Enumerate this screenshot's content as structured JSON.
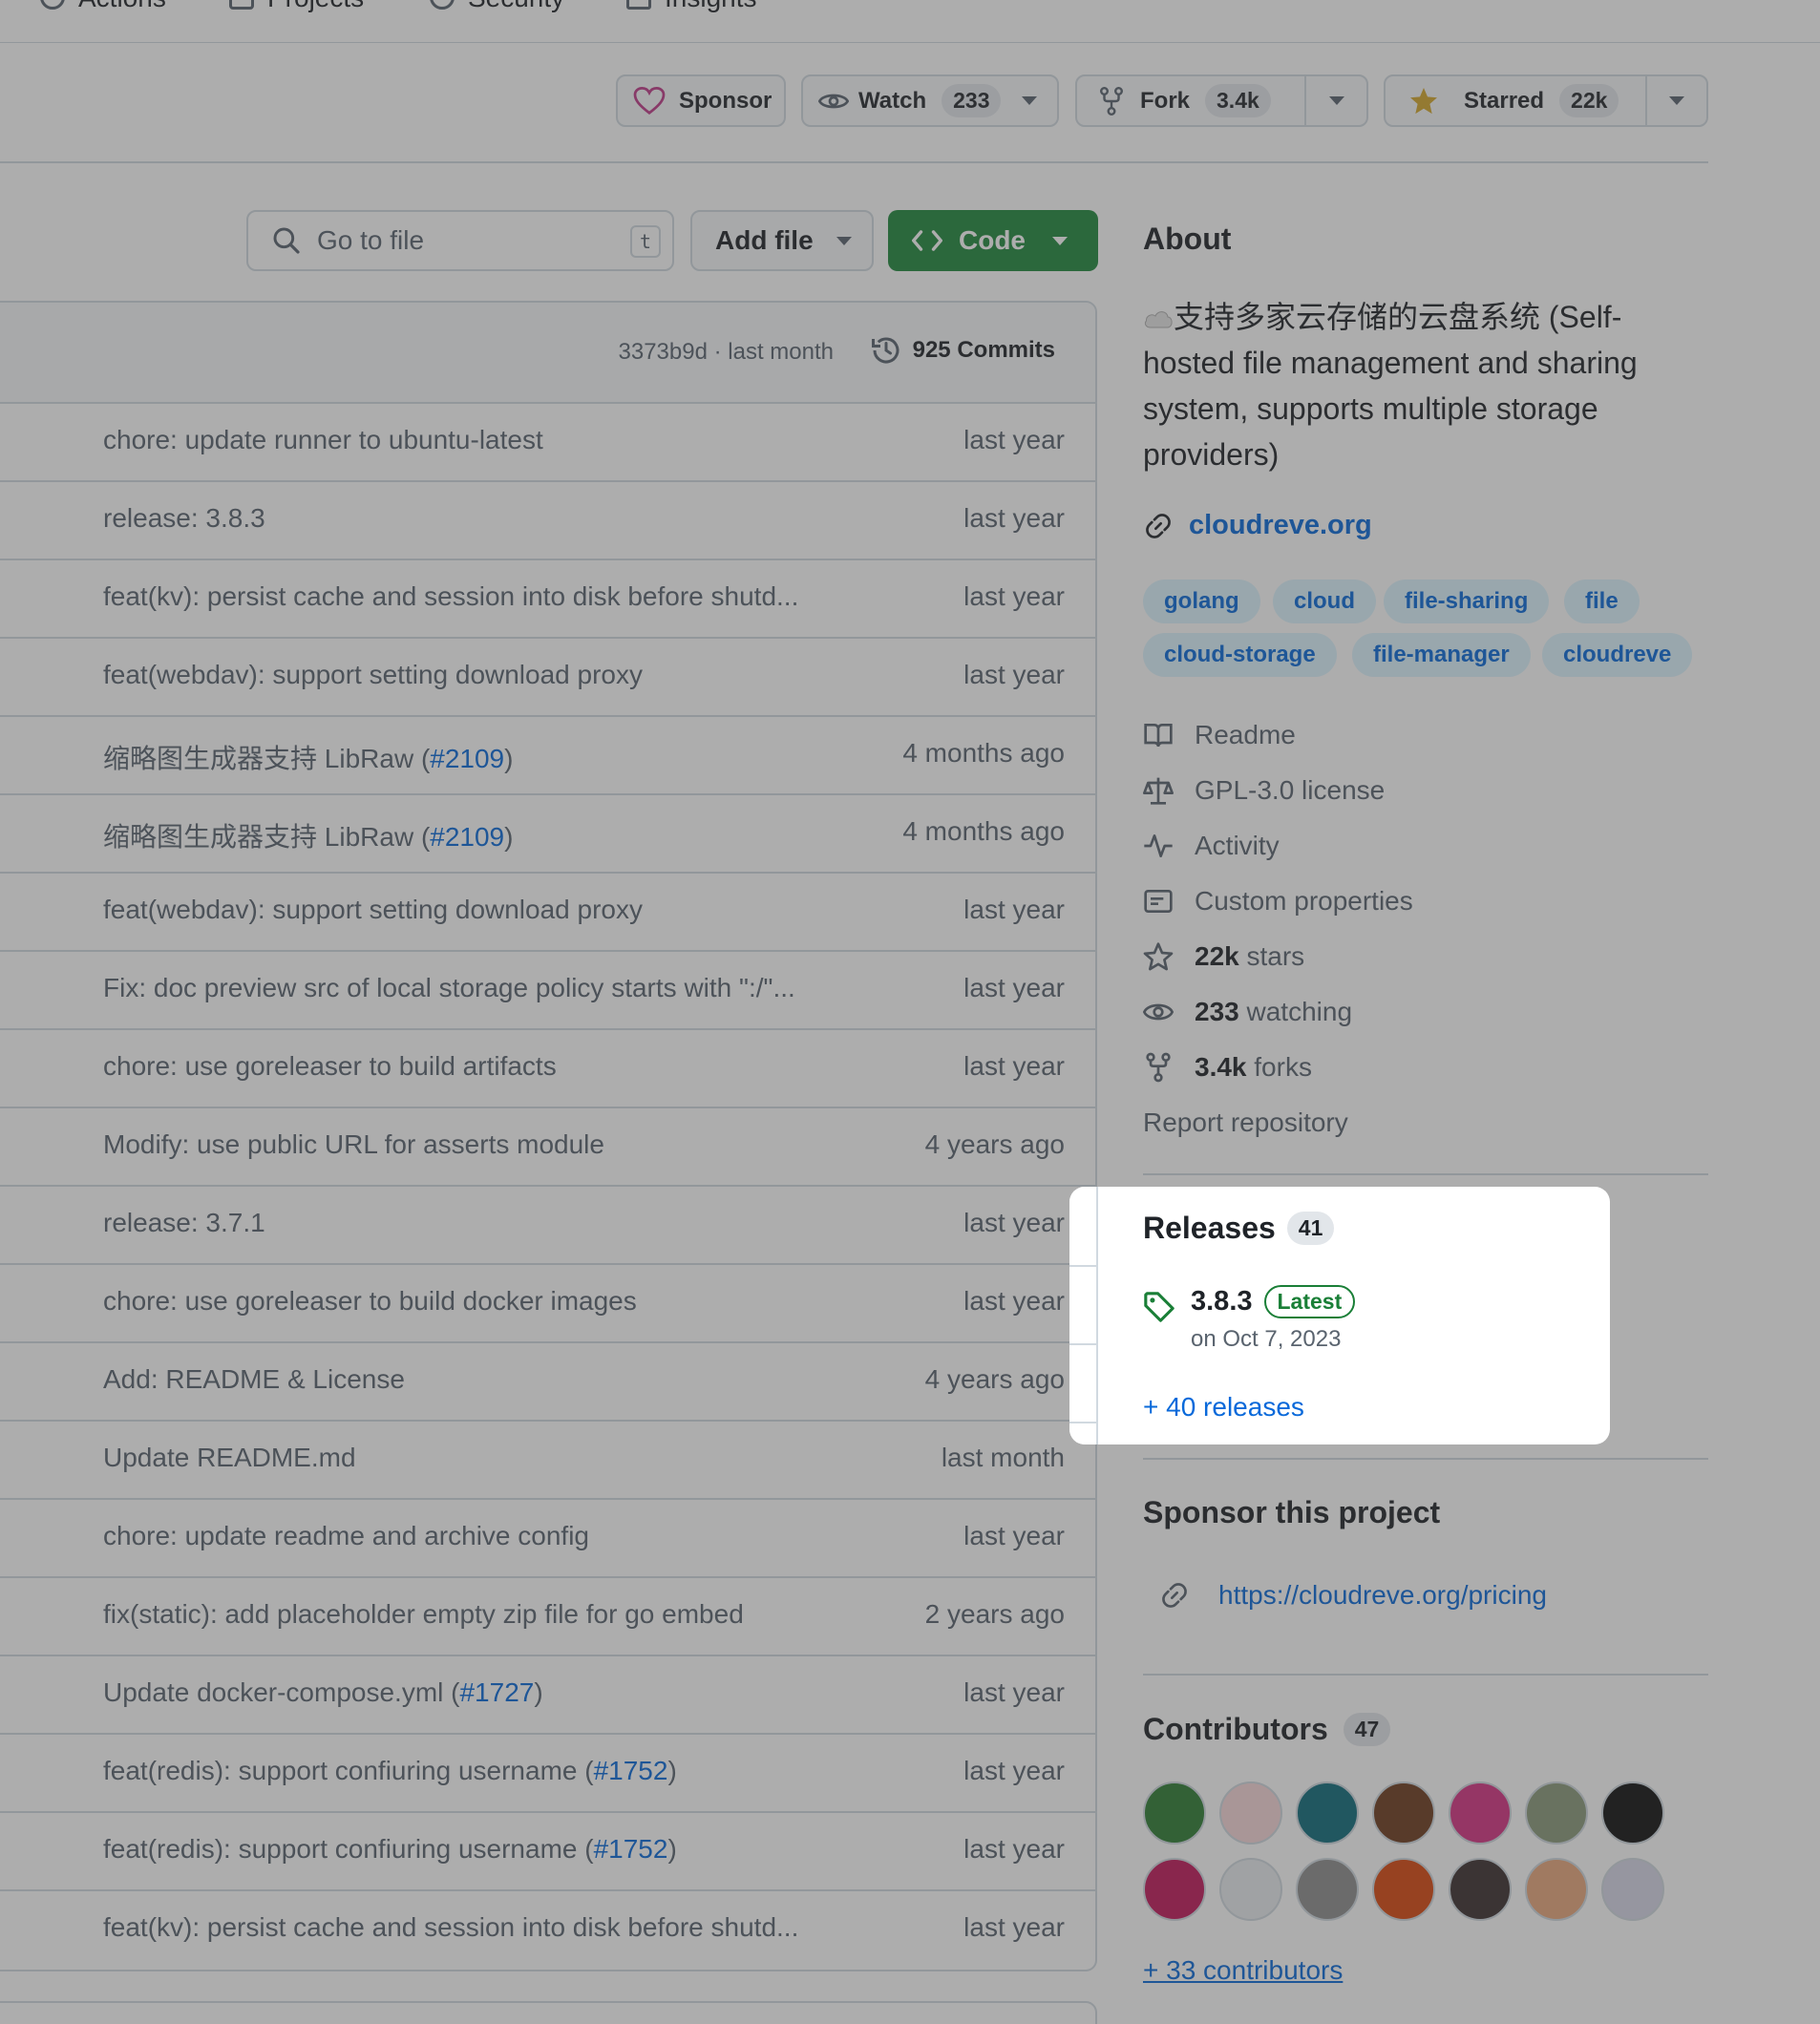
{
  "nav": {
    "items": [
      {
        "label": "Actions",
        "icon": "play-icon"
      },
      {
        "label": "Projects",
        "icon": "table-icon"
      },
      {
        "label": "Security",
        "icon": "shield-icon"
      },
      {
        "label": "Insights",
        "icon": "graph-icon"
      }
    ]
  },
  "header": {
    "sponsor_label": "Sponsor",
    "watch_label": "Watch",
    "watch_count": "233",
    "fork_label": "Fork",
    "fork_count": "3.4k",
    "starred_label": "Starred",
    "starred_count": "22k"
  },
  "toolbar": {
    "search_placeholder": "Go to file",
    "search_shortcut": "t",
    "add_file_label": "Add file",
    "code_label": "Code"
  },
  "commit_header": {
    "hash_info": "3373b9d · last month",
    "commits_label": "925 Commits"
  },
  "files": [
    {
      "message": "chore: update runner to ubuntu-latest",
      "when": "last year"
    },
    {
      "message": "release: 3.8.3",
      "when": "last year"
    },
    {
      "message": "feat(kv): persist cache and session into disk before shutd...",
      "when": "last year"
    },
    {
      "message": "feat(webdav): support setting download proxy",
      "when": "last year"
    },
    {
      "message": "缩略图生成器支持 LibRaw (",
      "link": "#2109",
      "suffix": ")",
      "when": "4 months ago"
    },
    {
      "message": "缩略图生成器支持 LibRaw (",
      "link": "#2109",
      "suffix": ")",
      "when": "4 months ago"
    },
    {
      "message": "feat(webdav): support setting download proxy",
      "when": "last year"
    },
    {
      "message": "Fix: doc preview src of local storage policy starts with \":/\"...",
      "when": "last year"
    },
    {
      "message": "chore: use goreleaser to build artifacts",
      "when": "last year"
    },
    {
      "message": "Modify: use public URL for asserts module",
      "when": "4 years ago"
    },
    {
      "message": "release: 3.7.1",
      "when": "last year"
    },
    {
      "message": "chore: use goreleaser to build docker images",
      "when": "last year"
    },
    {
      "message": "Add: README & License",
      "when": "4 years ago"
    },
    {
      "message": "Update README.md",
      "when": "last month"
    },
    {
      "message": "chore: update readme and archive config",
      "when": "last year"
    },
    {
      "message": "fix(static): add placeholder empty zip file for go embed",
      "when": "2 years ago"
    },
    {
      "message": "Update docker-compose.yml (",
      "link": "#1727",
      "suffix": ")",
      "when": "last year"
    },
    {
      "message": "feat(redis): support confiuring username (",
      "link": "#1752",
      "suffix": ")",
      "when": "last year"
    },
    {
      "message": "feat(redis): support confiuring username (",
      "link": "#1752",
      "suffix": ")",
      "when": "last year"
    },
    {
      "message": "feat(kv): persist cache and session into disk before shutd...",
      "when": "last year"
    }
  ],
  "about": {
    "title": "About",
    "description": "支持多家云存储的云盘系统 (Self-hosted file management and sharing system, supports multiple storage providers)",
    "website": "cloudreve.org",
    "topics": [
      "golang",
      "cloud",
      "file-sharing",
      "file",
      "cloud-storage",
      "file-manager",
      "cloudreve"
    ],
    "readme": "Readme",
    "license": "GPL-3.0 license",
    "activity": "Activity",
    "custom_properties": "Custom properties",
    "stars_count": "22k",
    "stars_label": "stars",
    "watching_count": "233",
    "watching_label": "watching",
    "forks_count": "3.4k",
    "forks_label": "forks",
    "report": "Report repository"
  },
  "releases": {
    "title": "Releases",
    "count": "41",
    "latest_version": "3.8.3",
    "latest_badge": "Latest",
    "latest_date": "on Oct 7, 2023",
    "more_link": "+ 40 releases"
  },
  "sponsor": {
    "title": "Sponsor this project",
    "url": "https://cloudreve.org/pricing"
  },
  "contributors": {
    "title": "Contributors",
    "count": "47",
    "more_link": "+ 33 contributors",
    "avatar_colors": [
      "#2e7d32",
      "#f8d7da",
      "#0f6c7a",
      "#6d3b1e",
      "#d63384",
      "#8a9a7b",
      "#111111",
      "#c2185b",
      "#e9ecef",
      "#8d8d8d",
      "#d9480f",
      "#3b2f2f",
      "#e8a87c",
      "#d7d7e8"
    ]
  },
  "colors": {
    "accent": "#0969da",
    "code_button": "#1f883d",
    "sponsor_heart": "#bf3989",
    "star": "#d4a72c"
  }
}
